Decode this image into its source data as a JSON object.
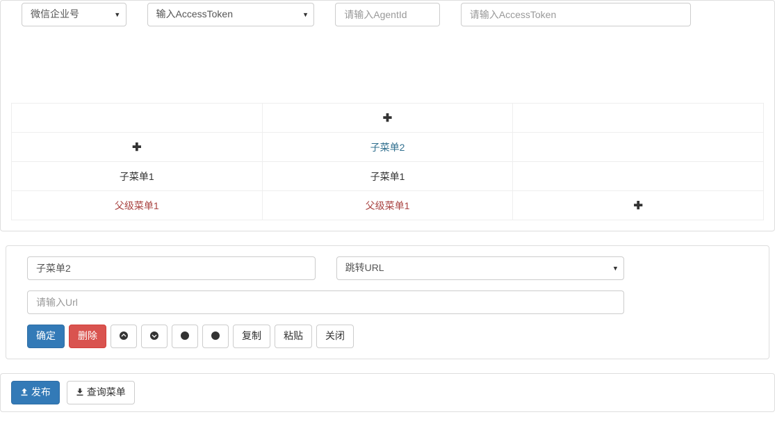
{
  "top": {
    "platform_options": [
      "微信企业号"
    ],
    "platform_selected": "微信企业号",
    "token_mode_options": [
      "输入AccessToken"
    ],
    "token_mode_selected": "输入AccessToken",
    "agentid_placeholder": "请输入AgentId",
    "accesstoken_placeholder": "请输入AccessToken"
  },
  "menu": {
    "columns": [
      {
        "parent": "父级菜单1",
        "items": [
          "子菜单1"
        ],
        "show_add": true
      },
      {
        "parent": "父级菜单1",
        "items": [
          "子菜单1",
          "子菜单2"
        ],
        "show_add": true,
        "selected_index": 1
      },
      {
        "parent": null,
        "items": [],
        "show_add_parent": true
      }
    ]
  },
  "edit": {
    "name_value": "子菜单2",
    "type_options": [
      "跳转URL"
    ],
    "type_selected": "跳转URL",
    "url_placeholder": "请输入Url",
    "buttons": {
      "ok": "确定",
      "delete": "删除",
      "copy": "复制",
      "paste": "粘贴",
      "close": "关闭"
    }
  },
  "footer": {
    "publish": "发布",
    "query": "查询菜单"
  }
}
